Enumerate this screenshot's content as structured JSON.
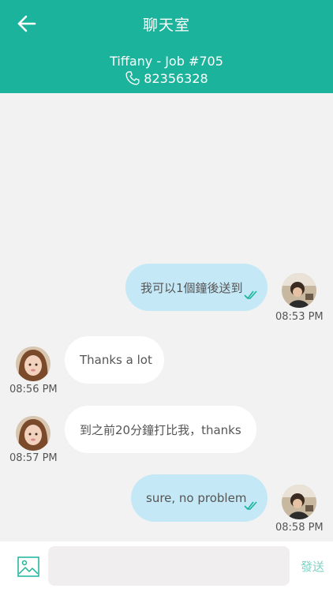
{
  "header": {
    "title": "聊天室",
    "contact": "Tiffany - Job #705",
    "phone": "82356328",
    "icons": {
      "back": "arrow-left-icon",
      "phone": "phone-icon"
    }
  },
  "messages": [
    {
      "direction": "out",
      "text": "我可以1個鐘後送到",
      "time": "08:53 PM",
      "read": true
    },
    {
      "direction": "in",
      "text": "Thanks a lot",
      "time": "08:56 PM"
    },
    {
      "direction": "in",
      "text": "到之前20分鐘打比我，thanks",
      "time": "08:57 PM"
    },
    {
      "direction": "out",
      "text": "sure, no problem",
      "time": "08:58 PM",
      "read": true
    }
  ],
  "composer": {
    "placeholder": "",
    "send_label": "發送",
    "image_icon": "image-icon"
  },
  "colors": {
    "header": "#1bb39b",
    "outgoing_bubble": "#c4e8f6",
    "incoming_bubble": "#ffffff",
    "send_label": "#7fd3c4"
  }
}
